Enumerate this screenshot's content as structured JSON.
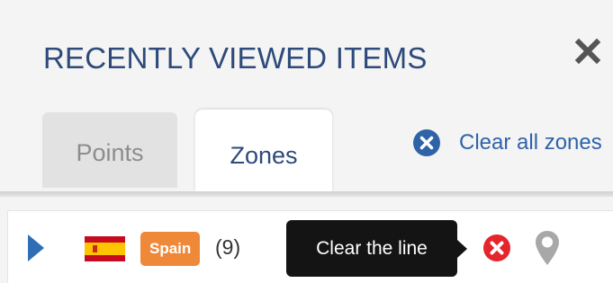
{
  "panel": {
    "title": "RECENTLY VIEWED ITEMS",
    "close_icon": "close-icon"
  },
  "tabs": [
    {
      "label": "Points",
      "active": false
    },
    {
      "label": "Zones",
      "active": true
    }
  ],
  "clear_all": {
    "label": "Clear all zones",
    "icon": "circle-x-icon"
  },
  "zone_row": {
    "expand_icon": "triangle-right-icon",
    "flag_icon": "spain-flag-icon",
    "badge": "Spain",
    "count": "(9)",
    "tooltip": "Clear the line",
    "remove_icon": "red-circle-x-icon",
    "locate_icon": "map-pin-icon"
  },
  "colors": {
    "title": "#2d4a7a",
    "link": "#2f63a8",
    "badge": "#f0883a",
    "expand": "#2f6db5",
    "remove": "#e5242b",
    "tooltip_bg": "#141414",
    "pin": "#a8a8a8"
  }
}
